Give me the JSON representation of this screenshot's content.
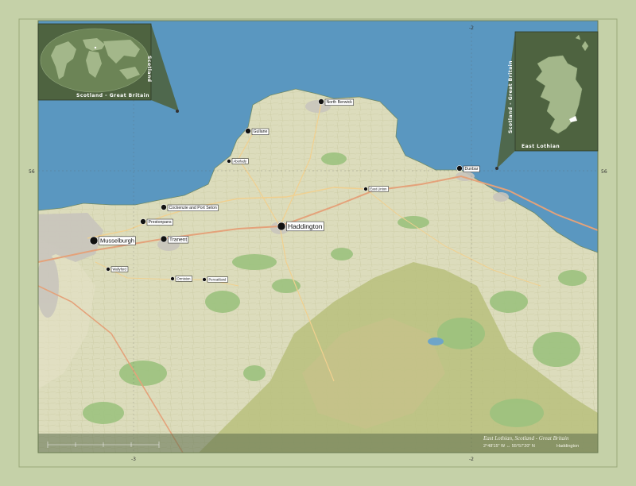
{
  "map": {
    "title": "East Lothian, Scotland - Great Britain",
    "coords": "2°48'15\" W ↔ 55°57'20\" N",
    "capital_credit": "Haddington",
    "colors": {
      "frame": "#c5d1a8",
      "frame_border": "#8b9a6e",
      "sea": "#5a97c0",
      "land": "#dfe0c0",
      "forest": "#a9c98a",
      "hills": "#b9c07c",
      "inset_bg": "#4e6340",
      "inset_land": "#a3b78a"
    },
    "grid_labels": {
      "top_left": "-3",
      "top_right": "-2",
      "left": "56",
      "right": "56",
      "bottom_left": "-3",
      "bottom_right": "-2"
    }
  },
  "insets": {
    "world": {
      "label": "Scotland - Great Britain",
      "side_label": "Scotland"
    },
    "scotland": {
      "label": "East Lothian",
      "side_label": "Scotland - Great Britain"
    }
  },
  "cities": [
    {
      "name": "North Berwick",
      "size": "small"
    },
    {
      "name": "Gullane",
      "size": "small"
    },
    {
      "name": "Aberlady",
      "size": "tiny"
    },
    {
      "name": "Dunbar",
      "size": "small"
    },
    {
      "name": "East Linton",
      "size": "tiny"
    },
    {
      "name": "Cockenzie and Port Seton",
      "size": "small"
    },
    {
      "name": "Prestonpans",
      "size": "small"
    },
    {
      "name": "Haddington",
      "size": "capital"
    },
    {
      "name": "Musselburgh",
      "size": "large"
    },
    {
      "name": "Tranent",
      "size": "medium"
    },
    {
      "name": "Wallyford",
      "size": "tiny"
    },
    {
      "name": "Ormiston",
      "size": "tiny"
    },
    {
      "name": "Pencaitland",
      "size": "tiny"
    }
  ]
}
